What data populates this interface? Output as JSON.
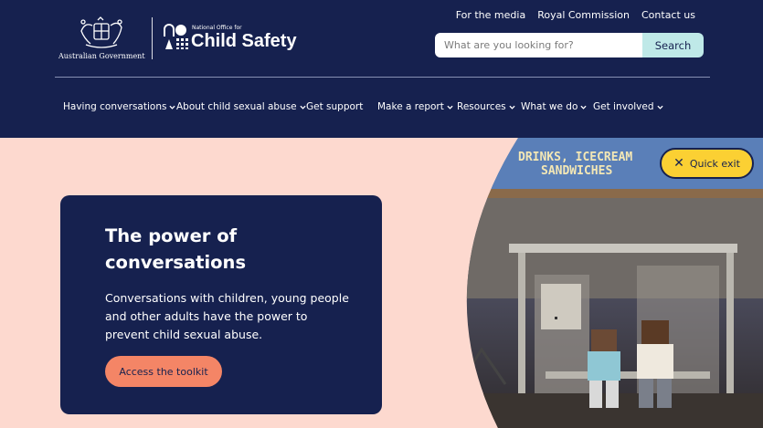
{
  "header": {
    "gov_logo_text": "Australian Government",
    "ncs_logo": {
      "sub": "National Office for",
      "main": "Child Safety"
    },
    "top_links": [
      "For the media",
      "Royal Commission",
      "Contact us"
    ],
    "search": {
      "placeholder": "What are you looking for?",
      "button": "Search"
    }
  },
  "nav": [
    {
      "label": "Having conversations",
      "dropdown": true
    },
    {
      "label": "About child sexual abuse",
      "dropdown": true
    },
    {
      "label": "Get support",
      "dropdown": false
    },
    {
      "label": "Make a report",
      "dropdown": true
    },
    {
      "label": "Resources",
      "dropdown": true
    },
    {
      "label": "What we do",
      "dropdown": true
    },
    {
      "label": "Get involved",
      "dropdown": true
    }
  ],
  "quick_exit": "Quick exit",
  "hero": {
    "title": "The power of conversations",
    "body": "Conversations with children, young people and other adults have the power to prevent child sexual abuse.",
    "cta": "Access the toolkit",
    "sign_text": "DRINKS, ICECREAM SANDWICHES"
  },
  "colors": {
    "navy": "#16214f",
    "peach_background": "#fdd9cf",
    "cta": "#f48566",
    "search_button": "#bfe9e8",
    "quick_exit": "#fbd033"
  }
}
